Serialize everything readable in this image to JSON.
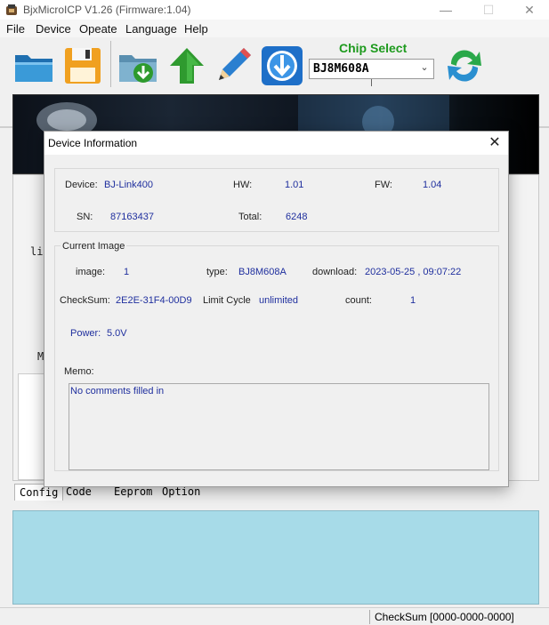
{
  "window": {
    "title": "BjxMicroICP V1.26 (Firmware:1.04)",
    "controls": {
      "minimize": "—",
      "maximize": "☐",
      "close": "✕"
    }
  },
  "menu": [
    "File",
    "Device",
    "Opeate",
    "Language",
    "Help"
  ],
  "toolbar": {
    "buttons": [
      "open-folder-icon",
      "save-floppy-icon",
      "download-to-folder-icon",
      "upload-arrow-icon",
      "edit-pencil-icon",
      "download-arrow-icon",
      "refresh-icon"
    ],
    "chip_select_label": "Chip Select",
    "chip_select_value": "BJ8M608A",
    "chip_select_arrow": "⌄"
  },
  "background": {
    "fragments": [
      "lin",
      "M"
    ],
    "tabs": [
      "Config",
      "Code",
      "Eeprom",
      "Option"
    ]
  },
  "status_bar": {
    "checksum": "CheckSum [0000-0000-0000]"
  },
  "dialog": {
    "title": "Device Information",
    "close": "✕",
    "device_label": "Device:",
    "device_value": "BJ-Link400",
    "hw_label": "HW:",
    "hw_value": "1.01",
    "fw_label": "FW:",
    "fw_value": "1.04",
    "sn_label": "SN:",
    "sn_value": "87163437",
    "total_label": "Total:",
    "total_value": "6248",
    "current_image_title": "Current Image",
    "image_label": "image:",
    "image_value": "1",
    "type_label": "type:",
    "type_value": "BJ8M608A",
    "download_label": "download:",
    "download_value": "2023-05-25 , 09:07:22",
    "checksum_label": "CheckSum:",
    "checksum_value": "2E2E-31F4-00D9",
    "limit_label": "Limit Cycle",
    "limit_value": "unlimited",
    "count_label": "count:",
    "count_value": "1",
    "power_label": "Power:",
    "power_value": "5.0V",
    "memo_label": "Memo:",
    "memo_text": "No comments filled in"
  },
  "colors": {
    "chip_select_label": "#1d9a1d",
    "value_text": "#1f2f9e",
    "log_area": "#a7dbe8"
  }
}
